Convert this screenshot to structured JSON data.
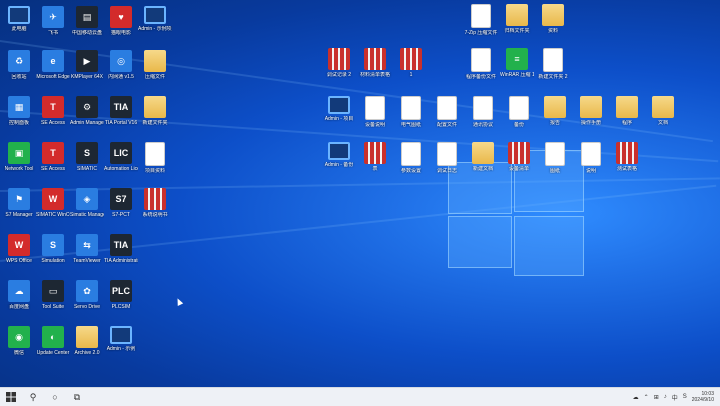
{
  "desktop": {
    "icons": [
      {
        "id": "i01",
        "label": "此电脑",
        "kind": "screen",
        "glyph": ""
      },
      {
        "id": "i02",
        "label": "飞书",
        "kind": "blue",
        "glyph": "✈"
      },
      {
        "id": "i03",
        "label": "中国移动云盘",
        "kind": "dark",
        "glyph": "▤"
      },
      {
        "id": "i04",
        "label": "猫眼电影",
        "kind": "red",
        "glyph": "♥"
      },
      {
        "id": "i05",
        "label": "Admin - 示例项目.zip",
        "kind": "screen",
        "glyph": ""
      },
      {
        "id": "i06",
        "label": "回收站",
        "kind": "blue",
        "glyph": "♻"
      },
      {
        "id": "i07",
        "label": "Microsoft Edge",
        "kind": "blue",
        "glyph": "e"
      },
      {
        "id": "i08",
        "label": "KMPlayer 64X",
        "kind": "dark",
        "glyph": "▶"
      },
      {
        "id": "i09",
        "label": "内网通 v1.5",
        "kind": "blue",
        "glyph": "◎"
      },
      {
        "id": "i10",
        "label": "压缩文件",
        "kind": "folder",
        "glyph": ""
      },
      {
        "id": "i11",
        "label": "控制面板",
        "kind": "blue",
        "glyph": "▦"
      },
      {
        "id": "i12",
        "label": "SE Access",
        "kind": "red",
        "glyph": "T"
      },
      {
        "id": "i13",
        "label": "Admin Manager",
        "kind": "dark",
        "glyph": "⚙"
      },
      {
        "id": "i14",
        "label": "TIA Portal V16",
        "kind": "dark",
        "glyph": "TIA"
      },
      {
        "id": "i15",
        "label": "新建文件夹",
        "kind": "folder",
        "glyph": ""
      },
      {
        "id": "i16",
        "label": "Network Tool",
        "kind": "green",
        "glyph": "▣"
      },
      {
        "id": "i17",
        "label": "SE Access",
        "kind": "red",
        "glyph": "T"
      },
      {
        "id": "i18",
        "label": "SIMATIC",
        "kind": "dark",
        "glyph": "S"
      },
      {
        "id": "i19",
        "label": "Automation License",
        "kind": "dark",
        "glyph": "LIC"
      },
      {
        "id": "i20",
        "label": "项目资料",
        "kind": "doc",
        "glyph": ""
      },
      {
        "id": "i21",
        "label": "S7 Manager",
        "kind": "blue",
        "glyph": "⚑"
      },
      {
        "id": "i22",
        "label": "SIMATIC WinCC",
        "kind": "red",
        "glyph": "W"
      },
      {
        "id": "i23",
        "label": "Simatic Manager",
        "kind": "blue",
        "glyph": "◈"
      },
      {
        "id": "i24",
        "label": "S7-PCT",
        "kind": "dark",
        "glyph": "S7"
      },
      {
        "id": "i25",
        "label": "系统说明书",
        "kind": "redgrid",
        "glyph": ""
      },
      {
        "id": "i26",
        "label": "WPS Office",
        "kind": "red",
        "glyph": "W"
      },
      {
        "id": "i27",
        "label": "Simulation",
        "kind": "blue",
        "glyph": "S"
      },
      {
        "id": "i28",
        "label": "TeamViewer",
        "kind": "blue",
        "glyph": "⇆"
      },
      {
        "id": "i29",
        "label": "TIA Administrator",
        "kind": "dark",
        "glyph": "TIA"
      },
      {
        "id": "i30",
        "label": "百度网盘",
        "kind": "blue",
        "glyph": "☁"
      },
      {
        "id": "i31",
        "label": "Tool Suite",
        "kind": "dark",
        "glyph": "▭"
      },
      {
        "id": "i32",
        "label": "Servo Drive",
        "kind": "blue",
        "glyph": "✿"
      },
      {
        "id": "i33",
        "label": "PLCSIM",
        "kind": "dark",
        "glyph": "PLC"
      },
      {
        "id": "i34",
        "label": "微信",
        "kind": "green",
        "glyph": "◉"
      },
      {
        "id": "i35",
        "label": "Update Center",
        "kind": "green",
        "glyph": "◐"
      },
      {
        "id": "i36",
        "label": "Archive 2.0",
        "kind": "folder",
        "glyph": ""
      },
      {
        "id": "i37",
        "label": "Admin - 示例",
        "kind": "screen",
        "glyph": ""
      },
      {
        "id": "r01",
        "label": "7-Zip 压缩文件",
        "kind": "doc",
        "glyph": ""
      },
      {
        "id": "r02",
        "label": "归档文件夹",
        "kind": "folder",
        "glyph": ""
      },
      {
        "id": "r03",
        "label": "资料",
        "kind": "folder",
        "glyph": ""
      },
      {
        "id": "r04",
        "label": "调试记录 2",
        "kind": "redgrid",
        "glyph": ""
      },
      {
        "id": "r05",
        "label": "材料清单表格",
        "kind": "redgrid",
        "glyph": ""
      },
      {
        "id": "r06",
        "label": "1",
        "kind": "redgrid",
        "glyph": ""
      },
      {
        "id": "r07",
        "label": "程序备份文件",
        "kind": "doc",
        "glyph": ""
      },
      {
        "id": "r08",
        "label": "WinRAR 压缩 1.2",
        "kind": "green",
        "glyph": "≡"
      },
      {
        "id": "r09",
        "label": "新建文件夹 2",
        "kind": "doc",
        "glyph": ""
      },
      {
        "id": "r10",
        "label": "Admin - 项目",
        "kind": "screen",
        "glyph": ""
      },
      {
        "id": "r11",
        "label": "设备说明",
        "kind": "doc",
        "glyph": ""
      },
      {
        "id": "r12",
        "label": "电气图纸",
        "kind": "doc",
        "glyph": ""
      },
      {
        "id": "r13",
        "label": "配置文件",
        "kind": "doc",
        "glyph": ""
      },
      {
        "id": "r14",
        "label": "通讯协议",
        "kind": "doc",
        "glyph": ""
      },
      {
        "id": "r15",
        "label": "备份",
        "kind": "doc",
        "glyph": ""
      },
      {
        "id": "r16",
        "label": "报告",
        "kind": "folder",
        "glyph": ""
      },
      {
        "id": "r17",
        "label": "操作手册",
        "kind": "folder",
        "glyph": ""
      },
      {
        "id": "r18",
        "label": "程序",
        "kind": "folder",
        "glyph": ""
      },
      {
        "id": "r19",
        "label": "文档",
        "kind": "folder",
        "glyph": ""
      },
      {
        "id": "r20",
        "label": "Admin - 备份",
        "kind": "screen",
        "glyph": ""
      },
      {
        "id": "r21",
        "label": "表",
        "kind": "redgrid",
        "glyph": ""
      },
      {
        "id": "r22",
        "label": "参数设置",
        "kind": "doc",
        "glyph": ""
      },
      {
        "id": "r23",
        "label": "调试日志",
        "kind": "doc",
        "glyph": ""
      },
      {
        "id": "r24",
        "label": "新建文档",
        "kind": "folder",
        "glyph": ""
      },
      {
        "id": "r25",
        "label": "设备清单",
        "kind": "redgrid",
        "glyph": ""
      },
      {
        "id": "r26",
        "label": "图纸",
        "kind": "doc",
        "glyph": ""
      },
      {
        "id": "r27",
        "label": "说明",
        "kind": "doc",
        "glyph": ""
      },
      {
        "id": "r28",
        "label": "测试表格",
        "kind": "redgrid",
        "glyph": ""
      }
    ]
  },
  "taskbar": {
    "start_icon": "windows-icon",
    "search_glyph": "⚲",
    "cortana_glyph": "○",
    "taskview_glyph": "⧉",
    "tray_glyphs": [
      "☁",
      "⌃",
      "⊞",
      "♪",
      "中",
      "S"
    ],
    "time": "10:03",
    "date": "2024/9/10"
  }
}
